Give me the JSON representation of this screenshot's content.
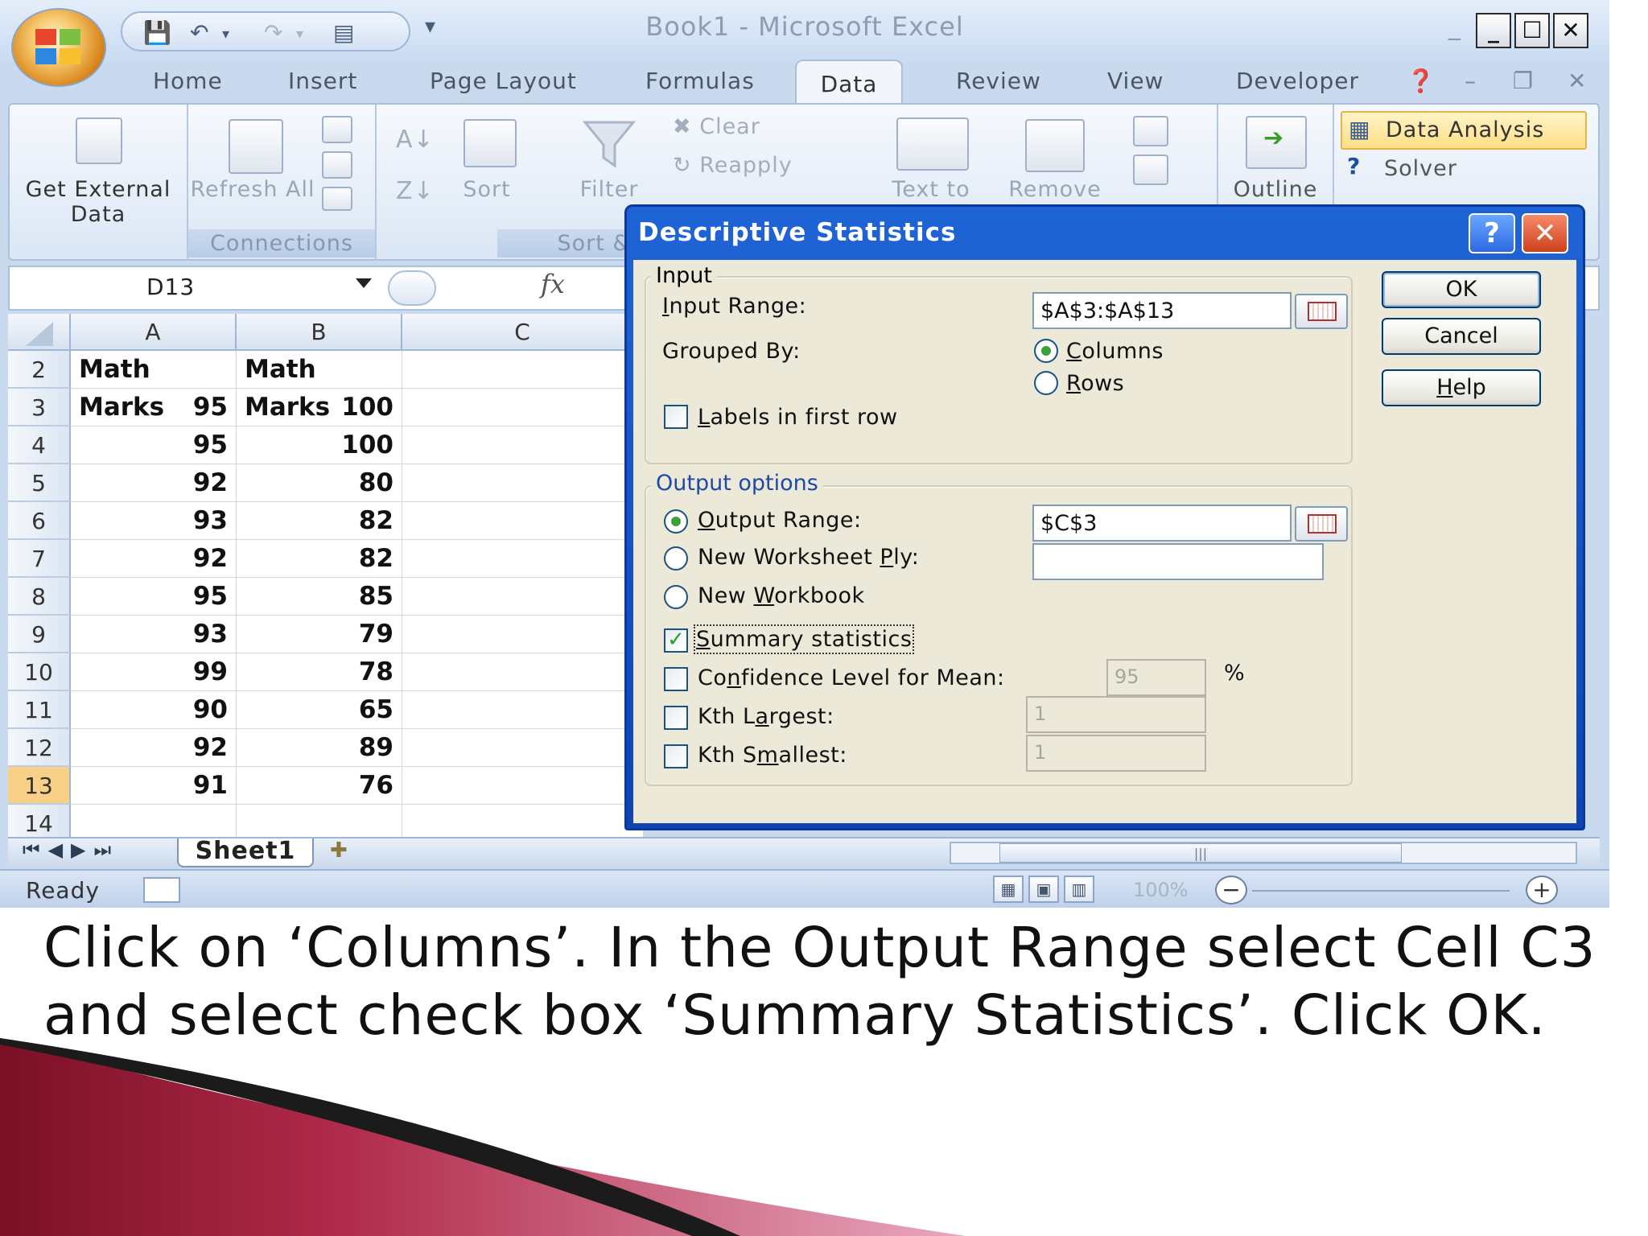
{
  "window": {
    "title": "Book1 - Microsoft Excel",
    "controls": {
      "minimize": "_",
      "maximize": "☐",
      "close": "✕"
    }
  },
  "ribbon_tabs": [
    "Home",
    "Insert",
    "Page Layout",
    "Formulas",
    "Data",
    "Review",
    "View",
    "Developer"
  ],
  "active_tab": "Data",
  "ribbon": {
    "get_external_data": "Get External Data",
    "refresh_all": "Refresh All",
    "connections_group": "Connections",
    "sort": "Sort",
    "sort_filter_group": "Sort &",
    "filter": "Filter",
    "clear": "Clear",
    "reapply": "Reapply",
    "text_to": "Text to",
    "remove": "Remove",
    "outline": "Outline",
    "data_analysis": "Data Analysis",
    "solver": "Solver"
  },
  "formula_bar": {
    "name_box": "D13",
    "fx": "fx"
  },
  "grid": {
    "columns": [
      "A",
      "B",
      "C"
    ],
    "rows": [
      {
        "num": "2",
        "a": "Math Marks",
        "b": "Math Marks"
      },
      {
        "num": "3",
        "a": "95",
        "b": "100"
      },
      {
        "num": "4",
        "a": "95",
        "b": "100"
      },
      {
        "num": "5",
        "a": "92",
        "b": "80"
      },
      {
        "num": "6",
        "a": "93",
        "b": "82"
      },
      {
        "num": "7",
        "a": "92",
        "b": "82"
      },
      {
        "num": "8",
        "a": "95",
        "b": "85"
      },
      {
        "num": "9",
        "a": "93",
        "b": "79"
      },
      {
        "num": "10",
        "a": "99",
        "b": "78"
      },
      {
        "num": "11",
        "a": "90",
        "b": "65"
      },
      {
        "num": "12",
        "a": "92",
        "b": "89"
      },
      {
        "num": "13",
        "a": "91",
        "b": "76"
      },
      {
        "num": "14",
        "a": "",
        "b": ""
      }
    ]
  },
  "sheet_tabs": [
    "Sheet1"
  ],
  "status": {
    "ready": "Ready",
    "zoom": "100%"
  },
  "dialog": {
    "title": "Descriptive Statistics",
    "input_legend": "Input",
    "input_range_label": "Input Range:",
    "input_range_value": "$A$3:$A$13",
    "grouped_by_label": "Grouped By:",
    "columns_label": "Columns",
    "rows_label": "Rows",
    "labels_first_row": "Labels in first row",
    "output_legend": "Output options",
    "output_range_label": "Output Range:",
    "output_range_value": "$C$3",
    "new_worksheet_ply": "New Worksheet Ply:",
    "new_workbook": "New Workbook",
    "summary_statistics": "Summary statistics",
    "confidence_level": "Confidence Level for Mean:",
    "confidence_value": "95",
    "percent": "%",
    "kth_largest": "Kth Largest:",
    "kth_largest_value": "1",
    "kth_smallest": "Kth Smallest:",
    "kth_smallest_value": "1",
    "ok": "OK",
    "cancel": "Cancel",
    "help": "Help",
    "grouped_by_selected": "columns",
    "output_selected": "output_range",
    "summary_checked": true
  },
  "caption": {
    "line1": "Click on ‘Columns’. In the Output Range select  Cell C3",
    "line2": "and select check box ‘Summary Statistics’. Click OK."
  }
}
